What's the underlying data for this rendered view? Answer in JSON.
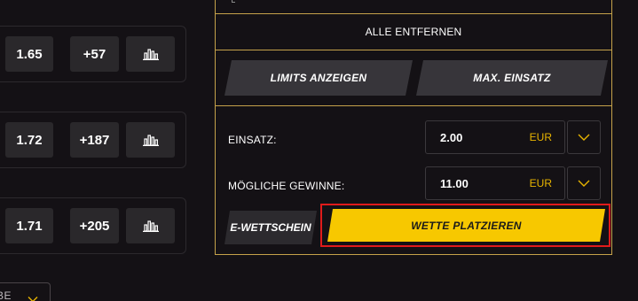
{
  "odds_rows": [
    {
      "odd": "1.65",
      "more": "+57"
    },
    {
      "odd": "1.72",
      "more": "+187"
    },
    {
      "odd": "1.71",
      "more": "+205"
    }
  ],
  "dropdown_fragment": {
    "text": "BE"
  },
  "bet_slip": {
    "remove_all_label": "ALLE ENTFERNEN",
    "show_limits_label": "LIMITS ANZEIGEN",
    "max_stake_label": "MAX. EINSATZ",
    "stake": {
      "label": "EINSATZ:",
      "value": "2.00",
      "currency": "EUR"
    },
    "possible_win": {
      "label": "MÖGLICHE GEWINNE:",
      "value": "11.00",
      "currency": "EUR"
    },
    "e_slip_label": "E-WETTSCHEIN",
    "place_bet_label": "WETTE PLATZIEREN"
  },
  "colors": {
    "accent_yellow": "#f7c800",
    "border_gold": "#c5a24a",
    "highlight_red": "#e01b1b",
    "currency": "#e8b400"
  },
  "icons": [
    "stats-icon",
    "chevron-down-icon"
  ]
}
